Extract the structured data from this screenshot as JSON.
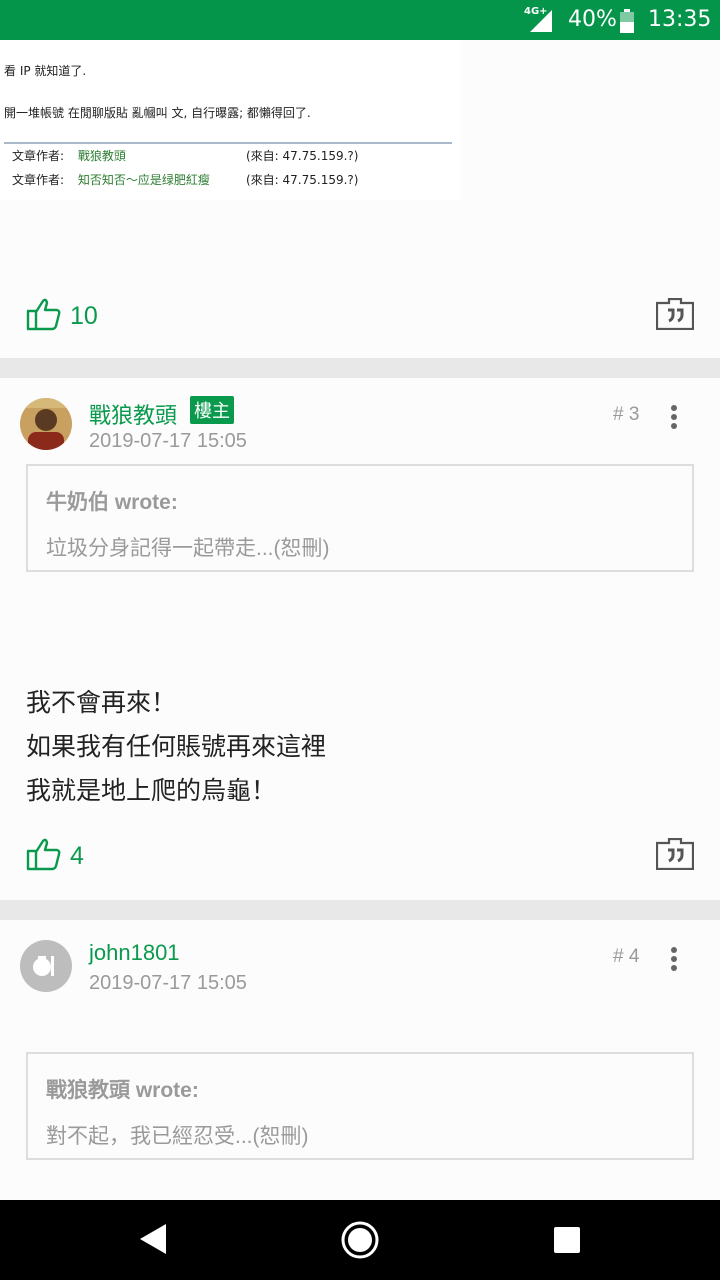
{
  "status_bar": {
    "network": "4G+",
    "battery": "40%",
    "time": "13:35"
  },
  "quoted_image": {
    "line1": "看 IP 就知道了.",
    "line2": "開一堆帳號 在閒聊版貼 亂幗叫 文, 自行曝露; 都懶得回了.",
    "rows": [
      {
        "label": "文章作者:",
        "author": "戰狼教頭",
        "ip": "(來自: 47.75.159.?)"
      },
      {
        "label": "文章作者:",
        "author": "知否知否～应是绿肥紅瘦",
        "ip": "(來自: 47.75.159.?)"
      }
    ]
  },
  "post_prev": {
    "likes": "10"
  },
  "post3": {
    "author": "戰狼教頭",
    "badge": "樓主",
    "time": "2019-07-17 15:05",
    "floor": "# 3",
    "quote": {
      "header": "牛奶伯 wrote:",
      "body": "垃圾分身記得一起帶走...(恕刪)"
    },
    "body": [
      "我不會再來！",
      "如果我有任何賬號再來這裡",
      "我就是地上爬的烏龜！"
    ],
    "likes": "4"
  },
  "post4": {
    "author": "john1801",
    "time": "2019-07-17 15:05",
    "floor": "# 4",
    "quote": {
      "header": "戰狼教頭 wrote:",
      "body": "對不起，我已經忍受...(恕刪)"
    }
  },
  "icons": {
    "like": "thumbs-up-icon",
    "quote": "quote-icon",
    "more": "more-vertical-icon",
    "nav": [
      "back-icon",
      "home-icon",
      "recents-icon"
    ]
  },
  "colors": {
    "accent": "#0a9a4d",
    "status_bar": "#04954a",
    "muted": "#9a9a9a"
  }
}
